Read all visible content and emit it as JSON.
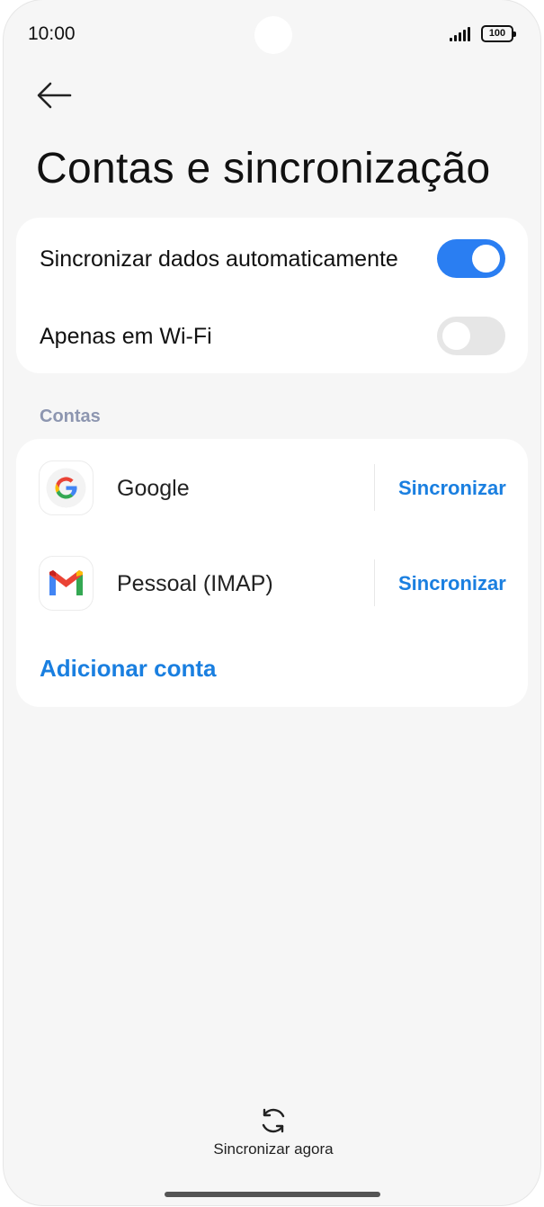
{
  "status_bar": {
    "time": "10:00",
    "battery": "100"
  },
  "header": {
    "title": "Contas e sincronização"
  },
  "settings": [
    {
      "label": "Sincronizar dados automaticamente",
      "enabled": true
    },
    {
      "label": "Apenas em Wi-Fi",
      "enabled": false
    }
  ],
  "accounts_section": {
    "title": "Contas",
    "items": [
      {
        "name": "Google",
        "icon": "google-icon",
        "action": "Sincronizar"
      },
      {
        "name": "Pessoal (IMAP)",
        "icon": "gmail-icon",
        "action": "Sincronizar"
      }
    ],
    "add_label": "Adicionar conta"
  },
  "footer": {
    "sync_now_label": "Sincronizar agora"
  },
  "colors": {
    "accent": "#2a7ef2",
    "link": "#1a7fe0",
    "toggle_off": "#e6e6e6",
    "section": "#8d96b0"
  }
}
